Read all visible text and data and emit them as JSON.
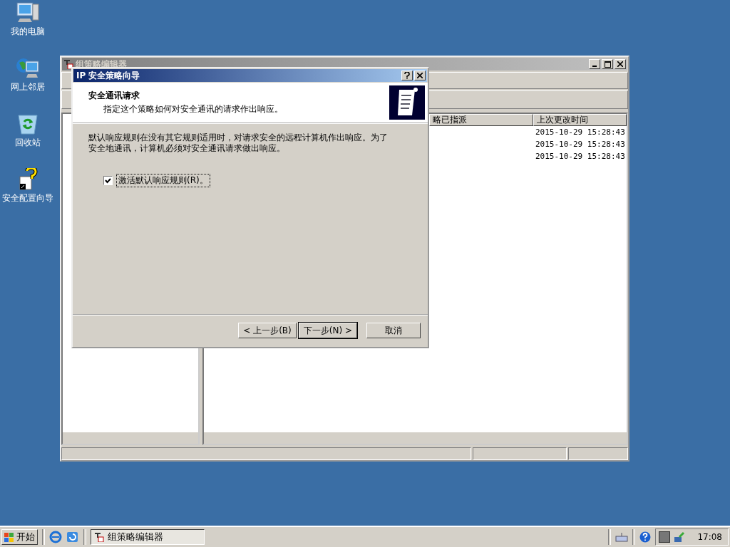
{
  "desktop_icons": [
    {
      "label": "我的电脑",
      "kind": "computer"
    },
    {
      "label": "网上邻居",
      "kind": "network"
    },
    {
      "label": "回收站",
      "kind": "recycle"
    },
    {
      "label": "安全配置向导",
      "kind": "wizard"
    }
  ],
  "main_window": {
    "title": "组策略编辑器",
    "columns": [
      "略已指派",
      "上次更改时间"
    ],
    "rows": [
      {
        "modified": "2015-10-29 15:28:43"
      },
      {
        "modified": "2015-10-29 15:28:43"
      },
      {
        "modified": "2015-10-29 15:28:43"
      }
    ]
  },
  "dialog": {
    "title": "IP 安全策略向导",
    "heading": "安全通讯请求",
    "subheading": "指定这个策略如何对安全通讯的请求作出响应。",
    "description": "默认响应规则在没有其它规则适用时，对请求安全的远程计算机作出响应。为了安全地通讯，计算机必须对安全通讯请求做出响应。",
    "checkbox": {
      "label": "激活默认响应规则(R)。",
      "checked": true
    },
    "buttons": [
      {
        "label": "< 上一步(B)",
        "default": false
      },
      {
        "label": "下一步(N) >",
        "default": true
      },
      {
        "label": "取消",
        "default": false
      }
    ]
  },
  "taskbar": {
    "start": "开始",
    "tasks": [
      {
        "label": "组策略编辑器",
        "selected": true
      }
    ],
    "clock": "17:08"
  }
}
